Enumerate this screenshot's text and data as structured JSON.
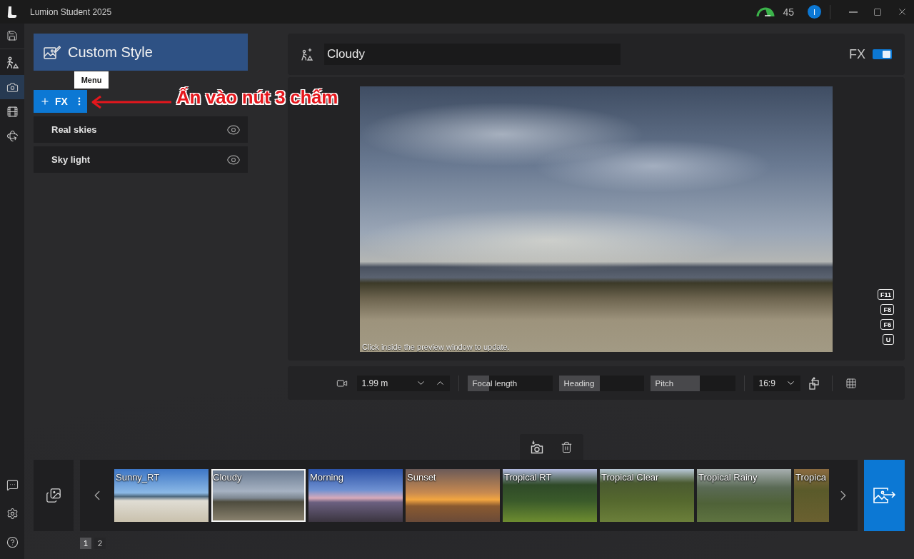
{
  "window": {
    "title": "Lumion Student 2025",
    "performance": "45",
    "user_initial": "I"
  },
  "nav_rail": {
    "top_items": [
      {
        "kind": "save",
        "selected": false
      },
      {
        "kind": "build",
        "selected": false
      },
      {
        "kind": "photo",
        "selected": true
      },
      {
        "kind": "movie",
        "selected": false
      },
      {
        "kind": "panorama",
        "selected": false
      }
    ],
    "bottom_items": [
      {
        "kind": "feedback"
      },
      {
        "kind": "settings"
      },
      {
        "kind": "help"
      }
    ]
  },
  "style_panel": {
    "title": "Custom Style",
    "add_label": "FX",
    "menu_tooltip": "Menu",
    "effects": [
      {
        "name": "Real skies",
        "visible": true
      },
      {
        "name": "Sky light",
        "visible": true
      }
    ]
  },
  "annotation": {
    "text": "Ấn vào nút 3 chấm"
  },
  "effect_bar": {
    "name": "Cloudy",
    "fx_label": "FX",
    "fx_on": true
  },
  "preview": {
    "hint": "Click inside the preview window to update.",
    "shortcuts": [
      "F11",
      "F8",
      "F6",
      "U"
    ]
  },
  "camera_bar": {
    "height": "1.99 m",
    "sliders": [
      {
        "label": "Focal length",
        "level": 0.26
      },
      {
        "label": "Heading",
        "level": 0.48
      },
      {
        "label": "Pitch",
        "level": 0.58
      }
    ],
    "aspect": "16:9"
  },
  "presets": {
    "items": [
      {
        "label": "Sunny_RT",
        "kind": "beach",
        "selected": false
      },
      {
        "label": "Cloudy",
        "kind": "overcast",
        "selected": true
      },
      {
        "label": "Morning",
        "kind": "dawn",
        "selected": false
      },
      {
        "label": "Sunset",
        "kind": "sunset",
        "selected": false
      },
      {
        "label": "Tropical RT",
        "kind": "jungle",
        "selected": false
      },
      {
        "label": "Tropical Clear",
        "kind": "clearing",
        "selected": false
      },
      {
        "label": "Tropical Rainy",
        "kind": "misty",
        "selected": false
      },
      {
        "label": "Tropica",
        "kind": "golden",
        "selected": false
      }
    ],
    "pages": [
      {
        "label": "1",
        "selected": true
      },
      {
        "label": "2",
        "selected": false
      }
    ]
  }
}
